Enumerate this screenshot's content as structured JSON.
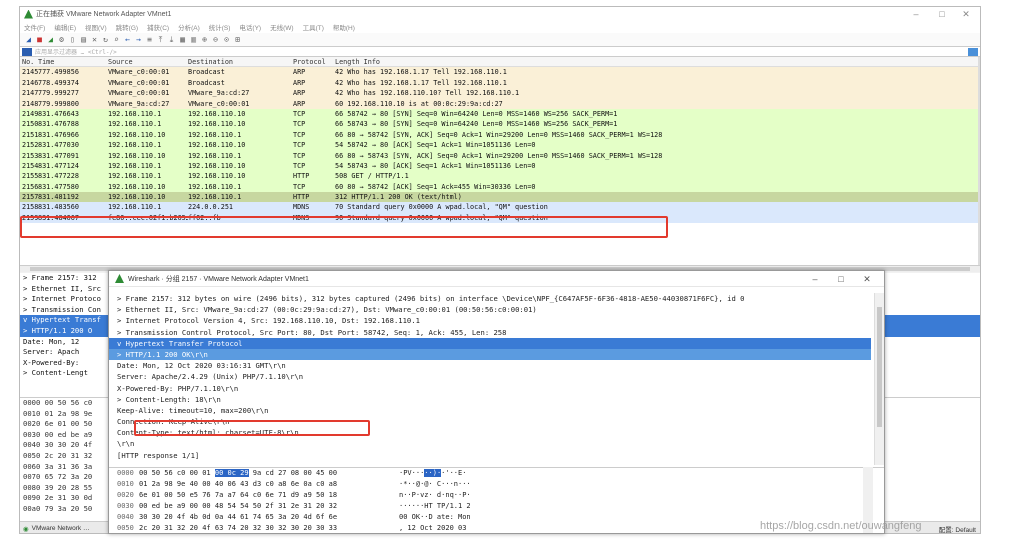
{
  "main_window": {
    "title": "正在捕获 VMware Network Adapter VMnet1",
    "menu": [
      "文件(F)",
      "编辑(E)",
      "视图(V)",
      "跳转(G)",
      "捕获(C)",
      "分析(A)",
      "统计(S)",
      "电话(Y)",
      "无线(W)",
      "工具(T)",
      "帮助(H)"
    ],
    "filter_placeholder": "应用显示过滤器 … <Ctrl-/>",
    "columns": {
      "no": "No.",
      "time": "Time",
      "source": "Source",
      "destination": "Destination",
      "protocol": "Protocol",
      "length_info": "Length Info"
    },
    "packets": [
      {
        "no": "2145",
        "time": "777.499856",
        "src": "VMware_c0:00:01",
        "dst": "Broadcast",
        "proto": "ARP",
        "info": "42 Who has 192.168.1.17 Tell 192.168.110.1",
        "color": "#faf0d7"
      },
      {
        "no": "2146",
        "time": "778.499374",
        "src": "VMware_c0:00:01",
        "dst": "Broadcast",
        "proto": "ARP",
        "info": "42 Who has 192.168.1.17 Tell 192.168.110.1",
        "color": "#faf0d7"
      },
      {
        "no": "2147",
        "time": "779.999277",
        "src": "VMware_c0:00:01",
        "dst": "VMware_9a:cd:27",
        "proto": "ARP",
        "info": "42 Who has 192.168.110.10? Tell 192.168.110.1",
        "color": "#faf0d7"
      },
      {
        "no": "2148",
        "time": "779.999800",
        "src": "VMware_9a:cd:27",
        "dst": "VMware_c0:00:01",
        "proto": "ARP",
        "info": "60 192.168.110.10 is at 00:0c:29:9a:cd:27",
        "color": "#faf0d7"
      },
      {
        "no": "2149",
        "time": "831.476643",
        "src": "192.168.110.1",
        "dst": "192.168.110.10",
        "proto": "TCP",
        "info": "66 58742 → 80 [SYN] Seq=0 Win=64240 Len=0 MSS=1460 WS=256 SACK_PERM=1",
        "color": "#e4ffc7"
      },
      {
        "no": "2150",
        "time": "831.476788",
        "src": "192.168.110.1",
        "dst": "192.168.110.10",
        "proto": "TCP",
        "info": "66 58743 → 80 [SYN] Seq=0 Win=64240 Len=0 MSS=1460 WS=256 SACK_PERM=1",
        "color": "#e4ffc7"
      },
      {
        "no": "2151",
        "time": "831.476966",
        "src": "192.168.110.10",
        "dst": "192.168.110.1",
        "proto": "TCP",
        "info": "66 80 → 58742 [SYN, ACK] Seq=0 Ack=1 Win=29200 Len=0 MSS=1460 SACK_PERM=1 WS=128",
        "color": "#e4ffc7"
      },
      {
        "no": "2152",
        "time": "831.477030",
        "src": "192.168.110.1",
        "dst": "192.168.110.10",
        "proto": "TCP",
        "info": "54 58742 → 80 [ACK] Seq=1 Ack=1 Win=1051136 Len=0",
        "color": "#e4ffc7"
      },
      {
        "no": "2153",
        "time": "831.477091",
        "src": "192.168.110.10",
        "dst": "192.168.110.1",
        "proto": "TCP",
        "info": "66 80 → 58743 [SYN, ACK] Seq=0 Ack=1 Win=29200 Len=0 MSS=1460 SACK_PERM=1 WS=128",
        "color": "#e4ffc7"
      },
      {
        "no": "2154",
        "time": "831.477124",
        "src": "192.168.110.1",
        "dst": "192.168.110.10",
        "proto": "TCP",
        "info": "54 58743 → 80 [ACK] Seq=1 Ack=1 Win=1051136 Len=0",
        "color": "#e4ffc7"
      },
      {
        "no": "2155",
        "time": "831.477228",
        "src": "192.168.110.1",
        "dst": "192.168.110.10",
        "proto": "HTTP",
        "info": "508 GET / HTTP/1.1",
        "color": "#e4ffc7"
      },
      {
        "no": "2156",
        "time": "831.477580",
        "src": "192.168.110.10",
        "dst": "192.168.110.1",
        "proto": "TCP",
        "info": "60 80 → 58742 [ACK] Seq=1 Ack=455 Win=30336 Len=0",
        "color": "#e4ffc7"
      },
      {
        "no": "2157",
        "time": "831.481192",
        "src": "192.168.110.10",
        "dst": "192.168.110.1",
        "proto": "HTTP",
        "info": "312 HTTP/1.1 200 OK  (text/html)",
        "color": "#c7d7a0"
      },
      {
        "no": "2158",
        "time": "831.483560",
        "src": "192.168.110.1",
        "dst": "224.0.0.251",
        "proto": "MDNS",
        "info": "70 Standard query 0x0000 A wpad.local, \"QM\" question",
        "color": "#dae8fc"
      },
      {
        "no": "2159",
        "time": "831.484067",
        "src": "fe80::cec:62f1:b205…",
        "dst": "ff02::fb",
        "proto": "MDNS",
        "info": "90 Standard query 0x0000 A wpad.local, \"QM\" question",
        "color": "#dae8fc"
      }
    ],
    "detail_lines": [
      "> Frame 2157: 312",
      "> Ethernet II, Src",
      "> Internet Protoco",
      "> Transmission Con",
      "v Hypertext Transf",
      "  > HTTP/1.1 200 O",
      "    Date: Mon, 12",
      "    Server: Apach",
      "    X-Powered-By:",
      "  > Content-Lengt"
    ],
    "hex_lines": [
      "0000  00 50 56 c0",
      "0010  01 2a 98 9e",
      "0020  6e 01 00 50",
      "0030  00 ed be a9",
      "0040  30 30 20 4f",
      "0050  2c 20 31 32",
      "0060  3a 31 36 3a",
      "0070  65 72 3a 20",
      "0080  39 20 28 55",
      "0090  2e 31 30 0d",
      "00a0  79 3a 20 50"
    ],
    "status_left": "VMware Network …",
    "status_right": "配置: Default"
  },
  "sub_window": {
    "title": "Wireshark · 分组 2157 · VMware Network Adapter VMnet1",
    "detail_lines": [
      {
        "text": "> Frame 2157: 312 bytes on wire (2496 bits), 312 bytes captured (2496 bits) on interface \\Device\\NPF_{C647AF5F-6F36-4818-AE50-44030871F6FC}, id 0",
        "cls": ""
      },
      {
        "text": "> Ethernet II, Src: VMware_9a:cd:27 (00:0c:29:9a:cd:27), Dst: VMware_c0:00:01 (00:50:56:c0:00:01)",
        "cls": ""
      },
      {
        "text": "> Internet Protocol Version 4, Src: 192.168.110.10, Dst: 192.168.110.1",
        "cls": ""
      },
      {
        "text": "> Transmission Control Protocol, Src Port: 80, Dst Port: 58742, Seq: 1, Ack: 455, Len: 258",
        "cls": ""
      },
      {
        "text": "v Hypertext Transfer Protocol",
        "cls": "sel"
      },
      {
        "text": "  > HTTP/1.1 200 OK\\r\\n",
        "cls": "hsel"
      },
      {
        "text": "      Date: Mon, 12 Oct 2020 03:16:31 GMT\\r\\n",
        "cls": ""
      },
      {
        "text": "      Server: Apache/2.4.29 (Unix) PHP/7.1.10\\r\\n",
        "cls": ""
      },
      {
        "text": "      X-Powered-By: PHP/7.1.10\\r\\n",
        "cls": ""
      },
      {
        "text": "  > Content-Length: 18\\r\\n",
        "cls": ""
      },
      {
        "text": "      Keep-Alive: timeout=10, max=200\\r\\n",
        "cls": ""
      },
      {
        "text": "      Connection: Keep-Alive\\r\\n",
        "cls": ""
      },
      {
        "text": "      Content-Type: text/html; charset=UTF-8\\r\\n",
        "cls": ""
      },
      {
        "text": "      \\r\\n",
        "cls": ""
      },
      {
        "text": "      [HTTP response 1/1]",
        "cls": ""
      }
    ],
    "hex_rows": [
      {
        "off": "0000",
        "pre": "00 50 56 c0 00 01 ",
        "mark": "00 0c  29",
        "post": " 9a cd 27 08 00 45 00",
        "ascii_pre": " ·PV···",
        "ascii_mark": "··)·",
        "ascii_post": "·'··E·"
      },
      {
        "off": "0010",
        "pre": "01 2a 98 9e 40 00 40 06  43 d3 c0 a8 6e 0a c0 a8",
        "mark": "",
        "post": "",
        "ascii_pre": " ·*··@·@· C···n···",
        "ascii_mark": "",
        "ascii_post": ""
      },
      {
        "off": "0020",
        "pre": "6e 01 00 50 e5 76 7a a7  64 c0 6e 71 d9 a9 50 18",
        "mark": "",
        "post": "",
        "ascii_pre": " n··P·vz· d·nq··P·",
        "ascii_mark": "",
        "ascii_post": ""
      },
      {
        "off": "0030",
        "pre": "00 ed be a9 00 00 48 54  54 50 2f 31 2e 31 20 32",
        "mark": "",
        "post": "",
        "ascii_pre": " ······HT TP/1.1 2",
        "ascii_mark": "",
        "ascii_post": ""
      },
      {
        "off": "0040",
        "pre": "30 30 20 4f 4b 0d 0a 44  61 74 65 3a 20 4d 6f 6e",
        "mark": "",
        "post": "",
        "ascii_pre": " 00 OK··D ate: Mon",
        "ascii_mark": "",
        "ascii_post": ""
      },
      {
        "off": "0050",
        "pre": "2c 20 31 32 20 4f 63 74  20 32 30 32 30 20 30 33",
        "mark": "",
        "post": "",
        "ascii_pre": " , 12 Oct  2020 03",
        "ascii_mark": "",
        "ascii_post": ""
      }
    ]
  },
  "watermark": "https://blog.csdn.net/ouwangfeng",
  "colors": {
    "highlight_box": "#e23a2e",
    "selection": "#3a7bd5"
  }
}
